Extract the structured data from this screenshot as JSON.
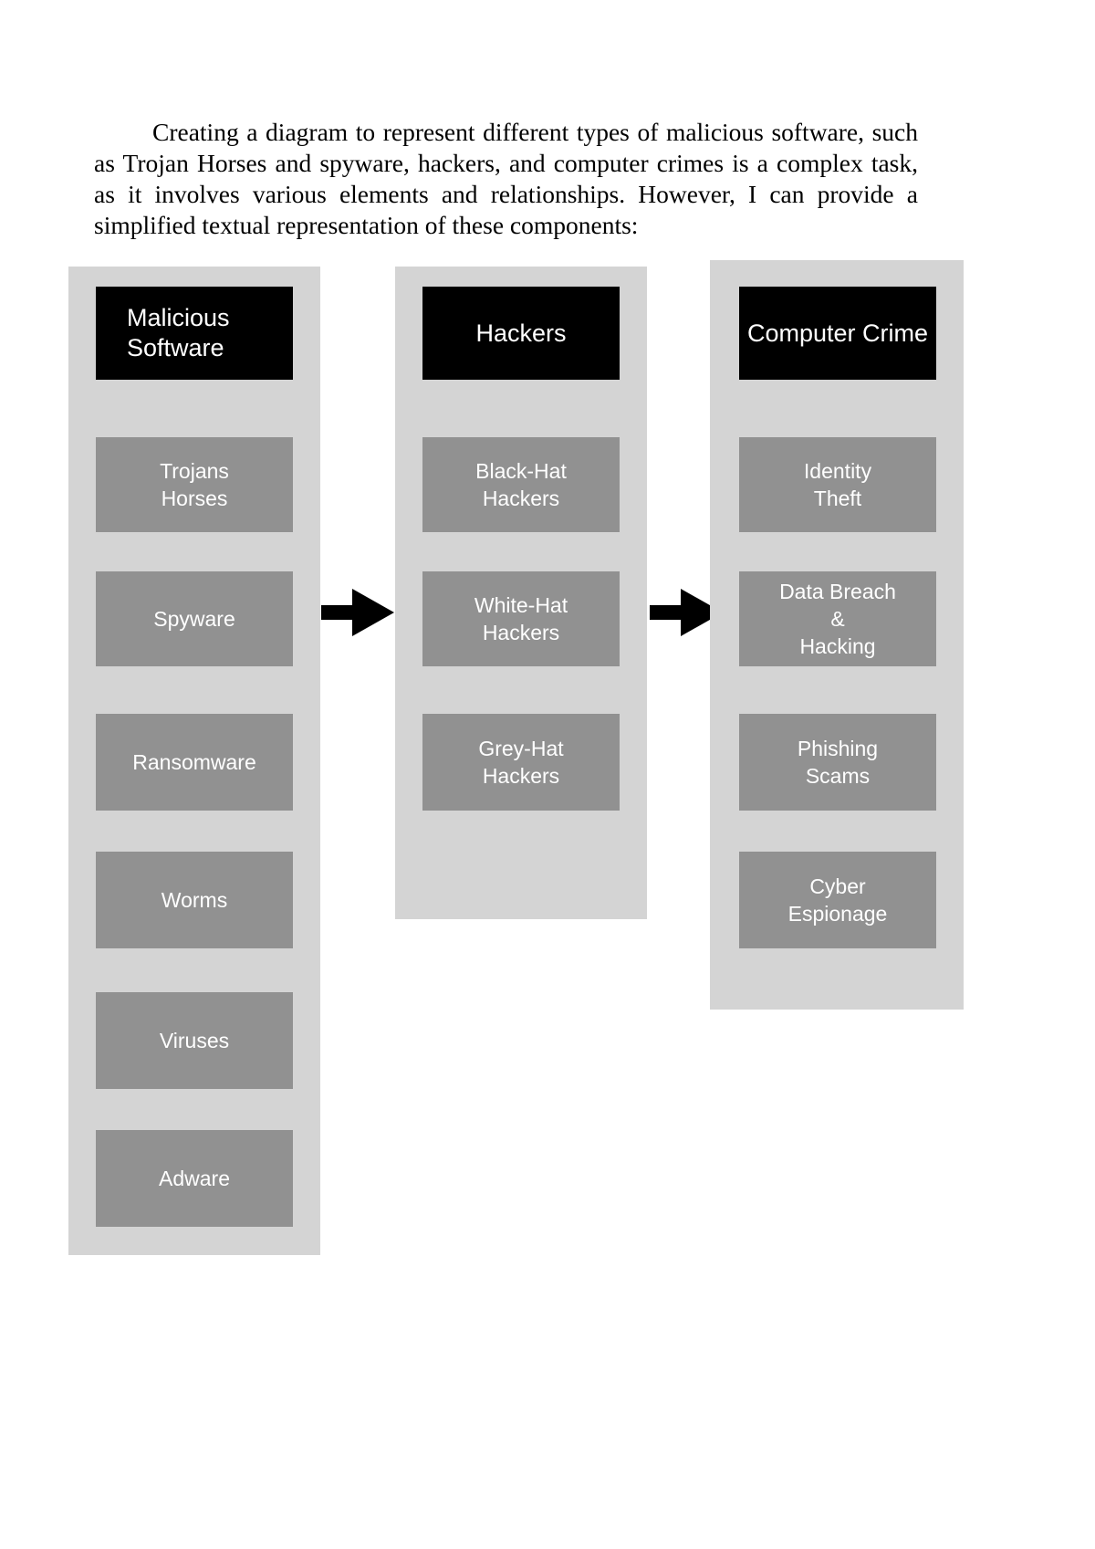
{
  "document": {
    "intro_paragraph": "Creating a diagram to represent different types of malicious software, such as Trojan Horses and spyware, hackers, and computer crimes is a complex task, as it involves various elements and relationships. However, I can provide a simplified textual representation of these components:"
  },
  "colors": {
    "page_background": "#ffffff",
    "panel_background": "#d4d4d4",
    "node_header_background": "#000000",
    "node_item_background": "#919191",
    "node_text": "#ffffff",
    "arrow": "#000000",
    "paragraph_text": "#000000"
  },
  "diagram": {
    "type": "three-column flow diagram",
    "columns": [
      {
        "id": "malicious-software",
        "header": "Malicious\nSoftware",
        "header_align": "left",
        "items": [
          "Trojans\nHorses",
          "Spyware",
          "Ransomware",
          "Worms",
          "Viruses",
          "Adware"
        ]
      },
      {
        "id": "hackers",
        "header": "Hackers",
        "header_align": "center",
        "items": [
          "Black-Hat\nHackers",
          "White-Hat\nHackers",
          "Grey-Hat\nHackers"
        ]
      },
      {
        "id": "computer-crime",
        "header": "Computer Crime",
        "header_align": "center",
        "items": [
          "Identity\nTheft",
          "Data Breach\n&\nHacking",
          "Phishing\nScams",
          "Cyber\nEspionage"
        ]
      }
    ],
    "arrows": [
      {
        "id": "arrow-malicious-to-hackers",
        "from": "malicious-software",
        "to": "hackers",
        "direction": "right"
      },
      {
        "id": "arrow-hackers-to-computer-crime",
        "from": "hackers",
        "to": "computer-crime",
        "direction": "right"
      }
    ]
  }
}
